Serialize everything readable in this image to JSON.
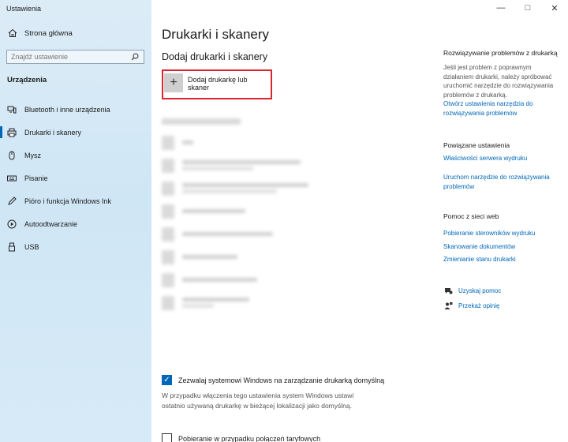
{
  "window": {
    "title": "Ustawienia"
  },
  "sidebar": {
    "home_label": "Strona główna",
    "search_placeholder": "Znajdź ustawienie",
    "section_title": "Urządzenia",
    "items": [
      {
        "label": "Bluetooth i inne urządzenia",
        "icon": "bluetooth-icon"
      },
      {
        "label": "Drukarki i skanery",
        "icon": "printer-icon",
        "active": true
      },
      {
        "label": "Mysz",
        "icon": "mouse-icon"
      },
      {
        "label": "Pisanie",
        "icon": "keyboard-icon"
      },
      {
        "label": "Pióro i funkcja Windows Ink",
        "icon": "pen-icon"
      },
      {
        "label": "Autoodtwarzanie",
        "icon": "autoplay-icon"
      },
      {
        "label": "USB",
        "icon": "usb-icon"
      }
    ]
  },
  "main": {
    "title": "Drukarki i skanery",
    "add_section_title": "Dodaj drukarki i skanery",
    "add_button_label": "Dodaj drukarkę lub skaner",
    "default_printer_checkbox": {
      "label": "Zezwalaj systemowi Windows na zarządzanie drukarką domyślną",
      "checked": true,
      "description": "W przypadku włączenia tego ustawienia system Windows ustawi ostatnio używaną drukarkę w bieżącej lokalizacji jako domyślną."
    },
    "metered_checkbox": {
      "label": "Pobieranie w przypadku połączeń taryfowych",
      "checked": false
    }
  },
  "right_panel": {
    "troubleshoot": {
      "heading": "Rozwiązywanie problemów z drukarką",
      "text": "Jeśli jest problem z poprawnym działaniem drukarki, należy spróbować uruchomić narzędzie do rozwiązywania problemów z drukarką.",
      "link": "Otwórz ustawienia narzędzia do rozwiązywania problemów"
    },
    "related": {
      "heading": "Powiązane ustawienia",
      "links": [
        "Właściwości serwera wydruku",
        "Uruchom narzędzie do rozwiązywania problemów"
      ]
    },
    "web_help": {
      "heading": "Pomoc z sieci web",
      "links": [
        "Pobieranie sterowników wydruku",
        "Skanowanie dokumentów",
        "Zmienianie stanu drukarki"
      ]
    },
    "get_help": "Uzyskaj pomoc",
    "feedback": "Przekaż opinię"
  },
  "colors": {
    "accent": "#0067b8",
    "highlight_border": "#e0242f",
    "sidebar_bg": "#d4e9f7"
  }
}
